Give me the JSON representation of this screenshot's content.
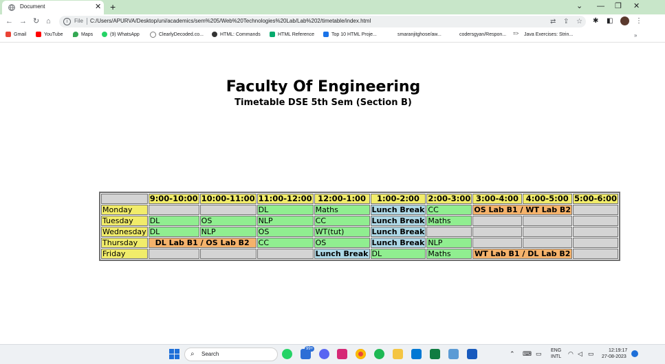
{
  "browser": {
    "tab_title": "Document",
    "url_scheme": "File",
    "url": "C:/Users/APURVA/Desktop/uni/academics/sem%205/Web%20Technologies%20Lab/Lab%202/timetable/index.html",
    "bookmarks": [
      {
        "label": "Gmail",
        "icon": "gmail-icon",
        "color": "#ea4335"
      },
      {
        "label": "YouTube",
        "icon": "youtube-icon",
        "color": "#ff0000"
      },
      {
        "label": "Maps",
        "icon": "maps-icon",
        "color": "#34a853"
      },
      {
        "label": "(9) WhatsApp",
        "icon": "whatsapp-icon",
        "color": "#25d366"
      },
      {
        "label": "ClearlyDecoded.co...",
        "icon": "clearlydecoded-icon",
        "color": "#7a7a7a"
      },
      {
        "label": "HTML: Commands",
        "icon": "globe-icon",
        "color": "#333333"
      },
      {
        "label": "HTML Reference",
        "icon": "w3schools-icon",
        "color": "#04aa6d"
      },
      {
        "label": "Top 10 HTML Proje...",
        "icon": "interviewbit-icon",
        "color": "#1a73e8"
      },
      {
        "label": "smaranjitghose/aw...",
        "icon": "github-icon",
        "color": "#ffffff"
      },
      {
        "label": "codersgyan/Respon...",
        "icon": "github-icon",
        "color": "#ffffff"
      },
      {
        "label": "Java Exercises: Strin...",
        "icon": "w3resource-icon",
        "color": "#4a4a4a"
      }
    ]
  },
  "page": {
    "title": "Faculty Of Engineering",
    "subtitle": "Timetable DSE 5th Sem (Section B)"
  },
  "timetable": {
    "columns": [
      "9:00-10:00",
      "10:00-11:00",
      "11:00-12:00",
      "12:00-1:00",
      "1:00-2:00",
      "2:00-3:00",
      "3:00-4:00",
      "4:00-5:00",
      "5:00-6:00"
    ],
    "rows": [
      {
        "day": "Monday",
        "cells": [
          {
            "text": "",
            "type": "empty"
          },
          {
            "text": "",
            "type": "empty"
          },
          {
            "text": "DL",
            "type": "sub"
          },
          {
            "text": "Maths",
            "type": "sub"
          },
          {
            "text": "Lunch Break",
            "type": "brk"
          },
          {
            "text": "CC",
            "type": "sub"
          },
          {
            "text": "OS Lab B1 / WT Lab B2",
            "type": "lab",
            "span": 2
          },
          {
            "text": "",
            "type": "empty"
          }
        ]
      },
      {
        "day": "Tuesday",
        "cells": [
          {
            "text": "DL",
            "type": "sub"
          },
          {
            "text": "OS",
            "type": "sub"
          },
          {
            "text": "NLP",
            "type": "sub"
          },
          {
            "text": "CC",
            "type": "sub"
          },
          {
            "text": "Lunch Break",
            "type": "brk"
          },
          {
            "text": "Maths",
            "type": "sub"
          },
          {
            "text": "",
            "type": "empty"
          },
          {
            "text": "",
            "type": "empty"
          },
          {
            "text": "",
            "type": "empty"
          }
        ]
      },
      {
        "day": "Wednesday",
        "cells": [
          {
            "text": "DL",
            "type": "sub"
          },
          {
            "text": "NLP",
            "type": "sub"
          },
          {
            "text": "OS",
            "type": "sub"
          },
          {
            "text": "WT(tut)",
            "type": "sub"
          },
          {
            "text": "Lunch Break",
            "type": "brk"
          },
          {
            "text": "",
            "type": "empty"
          },
          {
            "text": "",
            "type": "empty"
          },
          {
            "text": "",
            "type": "empty"
          },
          {
            "text": "",
            "type": "empty"
          }
        ]
      },
      {
        "day": "Thursday",
        "cells": [
          {
            "text": "DL Lab B1 / OS Lab B2",
            "type": "lab",
            "span": 2
          },
          {
            "text": "CC",
            "type": "sub"
          },
          {
            "text": "OS",
            "type": "sub"
          },
          {
            "text": "Lunch Break",
            "type": "brk"
          },
          {
            "text": "NLP",
            "type": "sub"
          },
          {
            "text": "",
            "type": "empty"
          },
          {
            "text": "",
            "type": "empty"
          },
          {
            "text": "",
            "type": "empty"
          }
        ]
      },
      {
        "day": "Friday",
        "cells": [
          {
            "text": "",
            "type": "empty"
          },
          {
            "text": "",
            "type": "empty"
          },
          {
            "text": "",
            "type": "empty"
          },
          {
            "text": "Lunch Break",
            "type": "brk"
          },
          {
            "text": "DL",
            "type": "sub"
          },
          {
            "text": "Maths",
            "type": "sub"
          },
          {
            "text": "WT Lab B1 / DL Lab B2",
            "type": "lab",
            "span": 2
          },
          {
            "text": "",
            "type": "empty"
          }
        ]
      }
    ]
  },
  "taskbar": {
    "search_label": "Search",
    "mail_badge": "99+",
    "language": "ENG",
    "layout": "INTL",
    "time": "12:19:17",
    "date": "27-08-2023"
  }
}
